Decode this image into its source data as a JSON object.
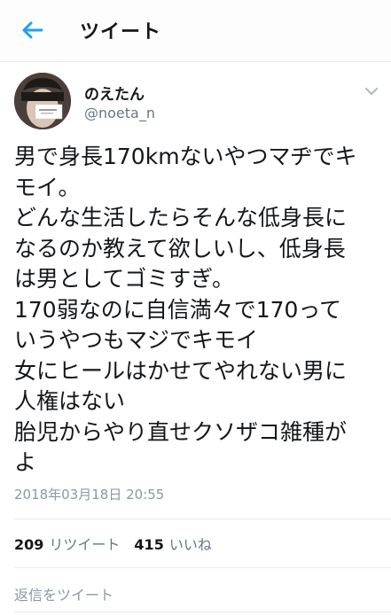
{
  "header": {
    "title": "ツイート",
    "back_icon": "arrow-left-icon",
    "accent_color": "#1da1f2"
  },
  "tweet": {
    "display_name": "のえたん",
    "handle": "@noeta_n",
    "avatar_icon": "user-avatar",
    "menu_icon": "chevron-down-icon",
    "lines": [
      "男で身長170kmないやつマヂでキ",
      "モイ。",
      "どんな生活したらそんな低身長に",
      "なるのか教えて欲しいし、低身長",
      "は男としてゴミすぎ。",
      "170弱なのに自信満々で170って",
      "いうやつもマジでキモイ",
      "女にヒールはかせてやれない男に",
      "人権はない",
      "胎児からやり直せクソザコ雑種が",
      "よ"
    ],
    "timestamp": "2018年03月18日 20:55"
  },
  "stats": {
    "retweet_count": "209",
    "retweet_label": "リツイート",
    "like_count": "415",
    "like_label": "いいね"
  },
  "reply": {
    "label": "返信をツイート"
  }
}
